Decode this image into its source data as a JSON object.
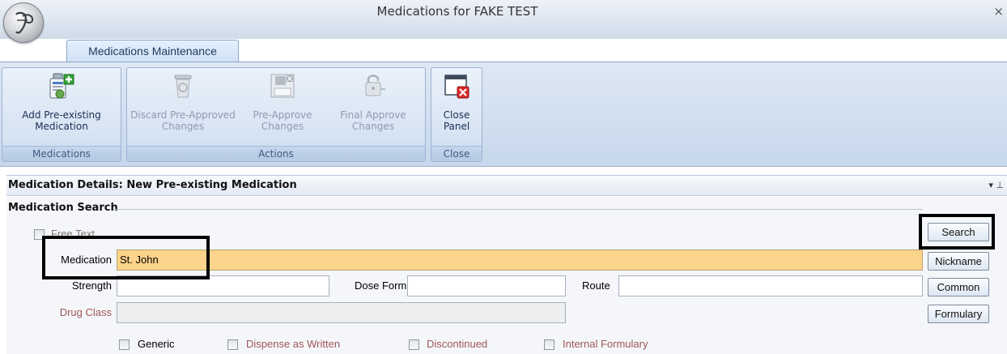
{
  "window": {
    "title": "Medications for FAKE TEST",
    "close_glyph": "×"
  },
  "ribbon": {
    "tab_label": "Medications Maintenance",
    "groups": [
      {
        "label": "Medications",
        "buttons": [
          {
            "label": "Add Pre-existing\nMedication",
            "icon": "add-medication-icon",
            "enabled": true
          }
        ]
      },
      {
        "label": "Actions",
        "buttons": [
          {
            "label": "Discard Pre-Approved\nChanges",
            "icon": "discard-icon",
            "enabled": false
          },
          {
            "label": "Pre-Approve\nChanges",
            "icon": "pre-approve-icon",
            "enabled": false
          },
          {
            "label": "Final Approve\nChanges",
            "icon": "final-approve-icon",
            "enabled": false
          }
        ]
      },
      {
        "label": "Close",
        "buttons": [
          {
            "label": "Close\nPanel",
            "icon": "close-panel-icon",
            "enabled": true
          }
        ]
      }
    ]
  },
  "panel": {
    "title": "Medication Details: New Pre-existing Medication",
    "pin_glyph": "▾ ⊥",
    "section_title": "Medication Search",
    "free_text_label": "Free Text",
    "fields": {
      "medication": {
        "label": "Medication",
        "value": "St. John"
      },
      "strength": {
        "label": "Strength",
        "value": ""
      },
      "dose_form": {
        "label": "Dose Form",
        "value": ""
      },
      "route": {
        "label": "Route",
        "value": ""
      },
      "drug_class": {
        "label": "Drug Class",
        "value": ""
      }
    },
    "buttons": {
      "search": "Search",
      "nickname": "Nickname",
      "common": "Common",
      "formulary": "Formulary"
    },
    "checkboxes": {
      "generic": "Generic",
      "dispense_as_written": "Dispense as Written",
      "discontinued": "Discontinued",
      "internal_formulary": "Internal Formulary"
    }
  },
  "colors": {
    "highlight_field": "#fcd38a",
    "disabled_text": "#a05656",
    "ribbon_text": "#1b2f55"
  }
}
